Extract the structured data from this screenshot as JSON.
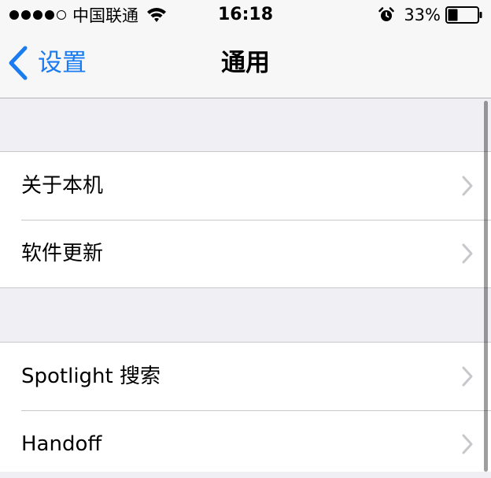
{
  "status_bar": {
    "carrier": "中国联通",
    "time": "16:18",
    "battery_percent": "33%",
    "signal_bars_filled": 4,
    "signal_bars_total": 5,
    "battery_level": 0.33
  },
  "nav": {
    "back_label": "设置",
    "title": "通用"
  },
  "groups": [
    {
      "items": [
        {
          "label": "关于本机"
        },
        {
          "label": "软件更新"
        }
      ]
    },
    {
      "items": [
        {
          "label": "Spotlight 搜索"
        },
        {
          "label": "Handoff"
        }
      ]
    }
  ],
  "colors": {
    "accent": "#1a7cf0",
    "background": "#efeff4",
    "cell_background": "#ffffff",
    "separator": "#c8c7cc",
    "chevron": "#c7c7cc"
  },
  "icons": {
    "back": "chevron-left-icon",
    "disclosure": "chevron-right-icon",
    "wifi": "wifi-icon",
    "alarm": "alarm-clock-icon",
    "battery": "battery-icon"
  }
}
